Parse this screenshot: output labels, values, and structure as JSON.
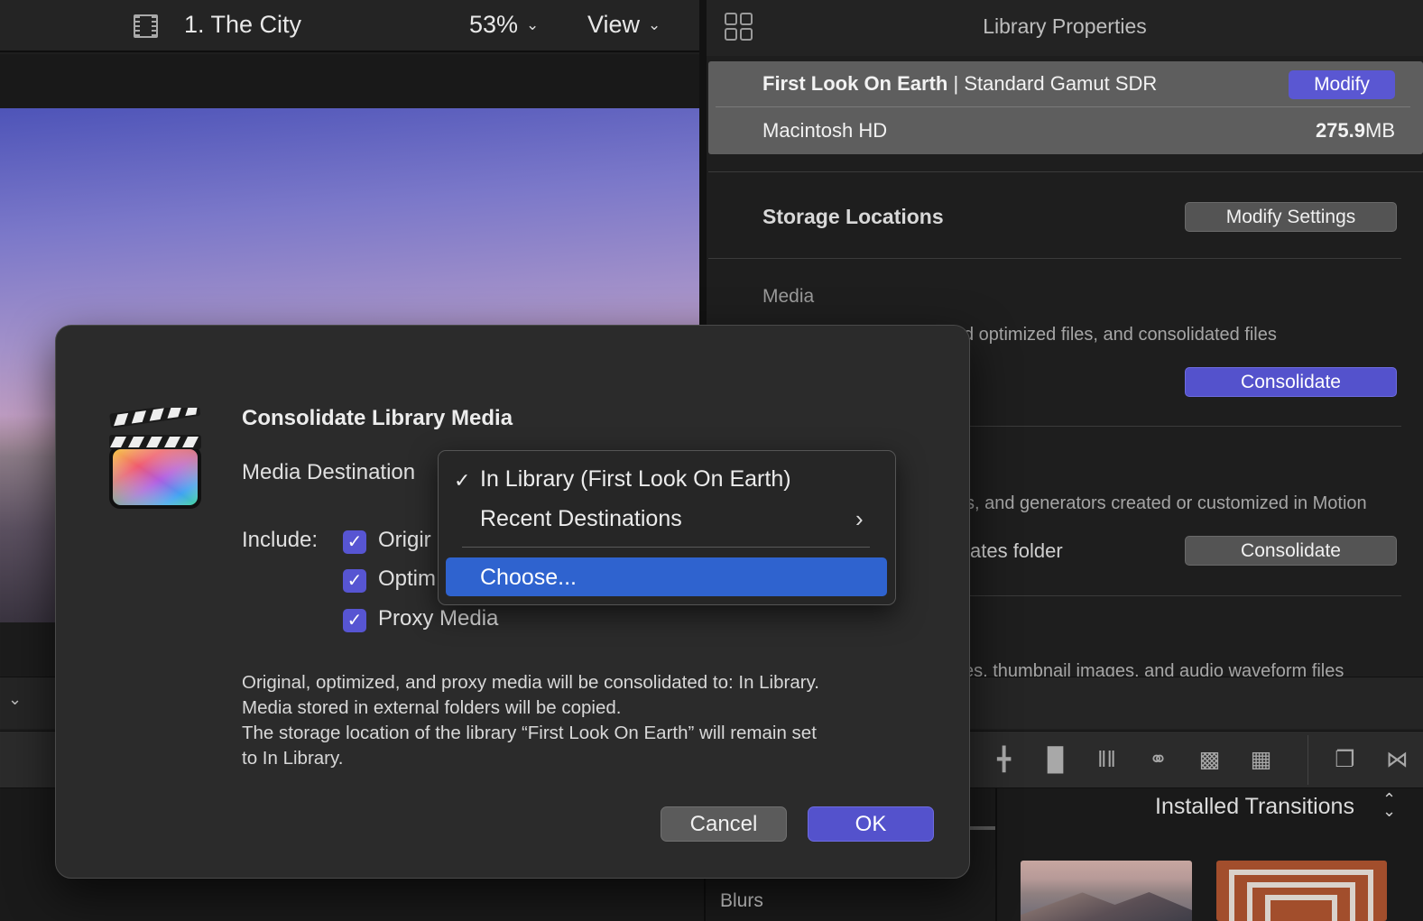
{
  "viewer": {
    "title": "1. The City",
    "zoom": "53%",
    "view_label": "View"
  },
  "inspector": {
    "title": "Library Properties",
    "library_name": "First Look On Earth",
    "library_separator": " | ",
    "color_space": "Standard Gamut SDR",
    "modify_label": "Modify",
    "volume": "Macintosh HD",
    "size_value": "275.9",
    "size_unit": "MB",
    "storage_title": "Storage Locations",
    "modify_settings_label": "Modify Settings",
    "media_label": "Media",
    "media_desc_partial": "d optimized files, and consolidated files",
    "consolidate_label": "Consolidate",
    "motion_desc_partial": "s, and generators created or customized in Motion",
    "templates_partial": "ates folder",
    "consolidate2_label": "Consolidate",
    "cache_desc_partial": "es, thumbnail images, and audio waveform files"
  },
  "browser": {
    "installed_label": "Installed Transitions",
    "blurs_label": "Blurs"
  },
  "dialog": {
    "title": "Consolidate Library Media",
    "destination_label": "Media Destination",
    "include_label": "Include:",
    "checkboxes": [
      {
        "label": "Origir",
        "checked": true
      },
      {
        "label": "Optim",
        "checked": true
      },
      {
        "label": "Proxy Media",
        "checked": true
      }
    ],
    "description": [
      "Original, optimized, and proxy media will be consolidated to: In Library.",
      "Media stored in external folders will be copied.",
      "The storage location of the library “First Look On Earth” will remain set",
      "to In Library."
    ],
    "cancel_label": "Cancel",
    "ok_label": "OK"
  },
  "menu": {
    "items": [
      {
        "label": "In Library (First Look On Earth)",
        "checked": true
      },
      {
        "label": "Recent Destinations",
        "submenu": true
      },
      {
        "label": "Choose...",
        "highlighted": true
      }
    ]
  },
  "colors": {
    "accent": "#5452cc",
    "menu_highlight": "#2f63cf",
    "dialog_bg": "#2b2b2b"
  }
}
